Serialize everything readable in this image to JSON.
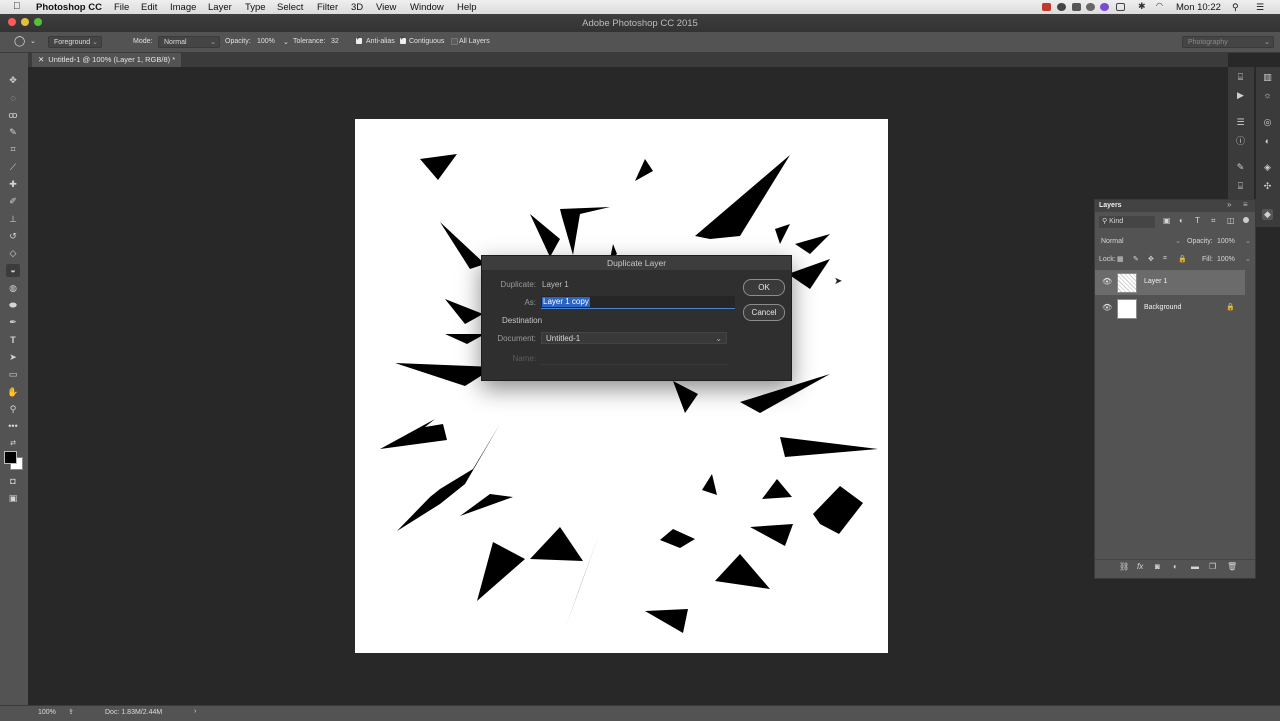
{
  "menubar": {
    "app_name": "Photoshop CC",
    "items": [
      "File",
      "Edit",
      "Image",
      "Layer",
      "Type",
      "Select",
      "Filter",
      "3D",
      "View",
      "Window",
      "Help"
    ],
    "clock": "Mon 10:22"
  },
  "window": {
    "title": "Adobe Photoshop CC 2015"
  },
  "options_bar": {
    "fill_source": "Foreground",
    "mode_label": "Mode:",
    "mode_value": "Normal",
    "opacity_label": "Opacity:",
    "opacity_value": "100%",
    "tolerance_label": "Tolerance:",
    "tolerance_value": "32",
    "anti_alias_label": "Anti-alias",
    "anti_alias_checked": true,
    "contiguous_label": "Contiguous",
    "contiguous_checked": true,
    "all_layers_label": "All Layers",
    "all_layers_checked": false,
    "workspace": "Photography"
  },
  "document_tab": {
    "label": "Untitled-1 @ 100% (Layer 1, RGB/8) *"
  },
  "dialog": {
    "title": "Duplicate Layer",
    "duplicate_label": "Duplicate:",
    "duplicate_value": "Layer 1",
    "as_label": "As:",
    "as_value": "Layer 1 copy",
    "destination_label": "Destination",
    "document_label": "Document:",
    "document_value": "Untitled-1",
    "name_label": "Name:",
    "ok_label": "OK",
    "cancel_label": "Cancel"
  },
  "layers_panel": {
    "title": "Layers",
    "filter_kind": "Kind",
    "blend_mode": "Normal",
    "opacity_label": "Opacity:",
    "opacity_value": "100%",
    "lock_label": "Lock:",
    "fill_label": "Fill:",
    "fill_value": "100%",
    "layers": [
      {
        "name": "Layer 1",
        "active": true
      },
      {
        "name": "Background",
        "active": false,
        "locked": true
      }
    ]
  },
  "status_bar": {
    "zoom": "100%",
    "doc_info": "Doc: 1.83M/2.44M"
  },
  "colors": {
    "ui_dark": "#282828",
    "panel": "#535353",
    "selection_blue": "#2a65c4"
  }
}
